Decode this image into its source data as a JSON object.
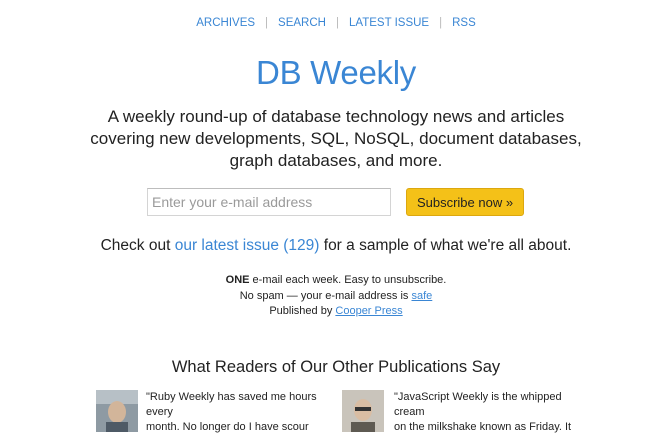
{
  "nav": {
    "items": [
      "ARCHIVES",
      "SEARCH",
      "LATEST ISSUE",
      "RSS"
    ]
  },
  "site_title": "DB Weekly",
  "description": "A weekly round-up of database technology news and articles covering new developments, SQL, NoSQL, document databases, graph databases, and more.",
  "signup": {
    "email_placeholder": "Enter your e-mail address",
    "button_label": "Subscribe now »"
  },
  "checkout": {
    "prefix": "Check out ",
    "link": "our latest issue (129)",
    "suffix": " for a sample of what we're all about."
  },
  "fine_print": {
    "line1_bold": "ONE",
    "line1_rest": " e-mail each week. Easy to unsubscribe.",
    "line2_prefix": "No spam — your e-mail address is ",
    "line2_link": "safe",
    "line3_prefix": "Published by ",
    "line3_link": "Cooper Press"
  },
  "readers_heading": "What Readers of Our Other Publications Say",
  "testimonials": [
    {
      "line1": "\"Ruby Weekly has saved me hours every",
      "line2": "month. No longer do I have scour"
    },
    {
      "line1": "\"JavaScript Weekly is the whipped cream",
      "line2": "on the milkshake known as Friday. It"
    }
  ],
  "colors": {
    "accent": "#3a86d4",
    "button": "#f4c118"
  }
}
